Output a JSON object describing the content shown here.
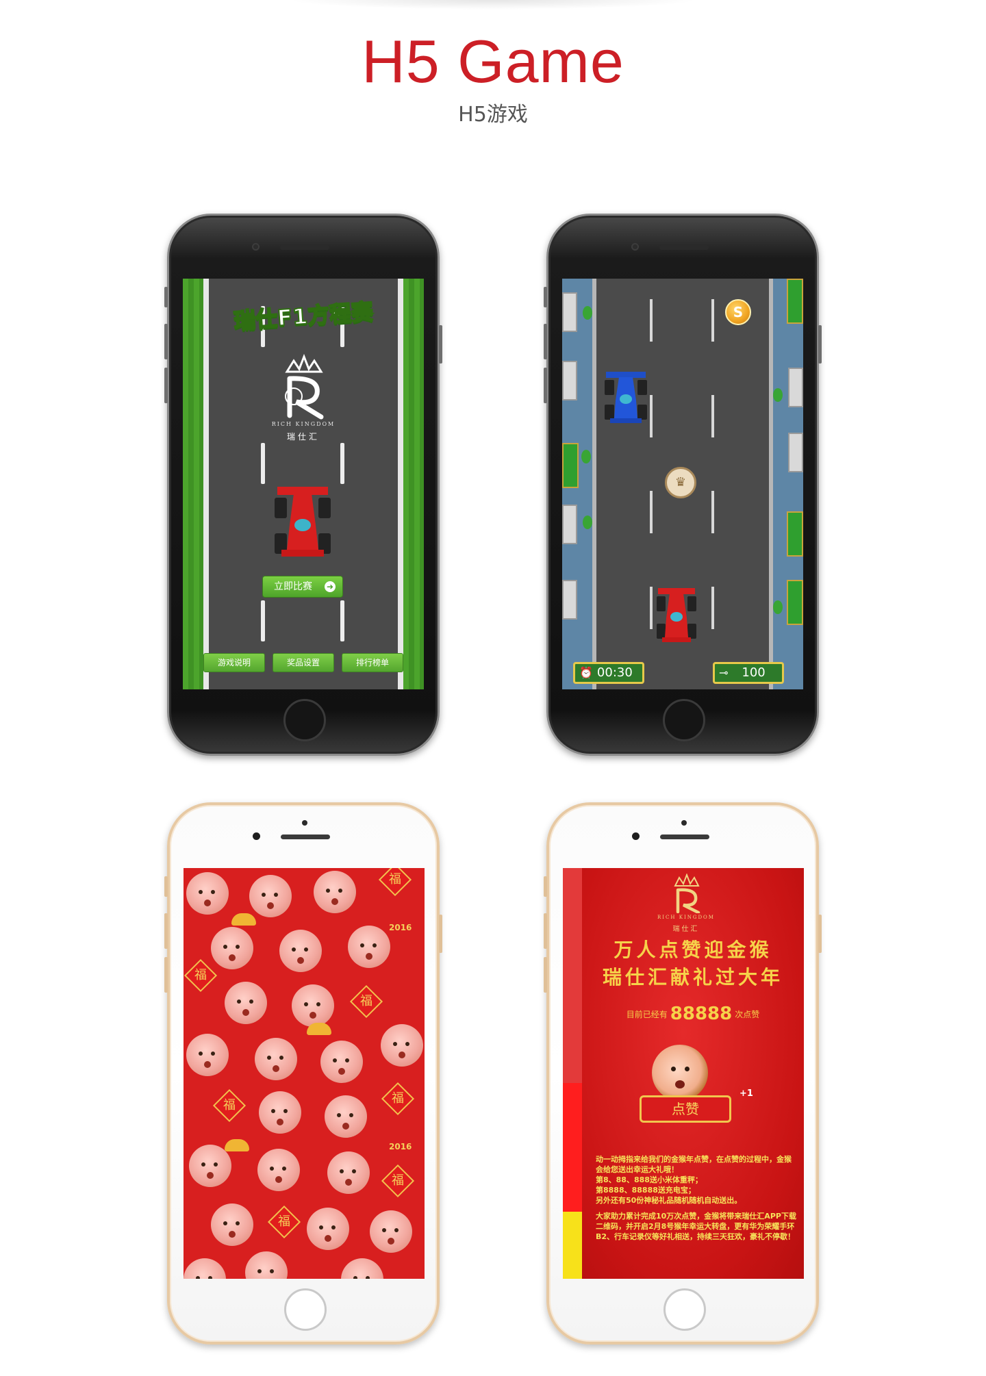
{
  "header": {
    "title": "H5 Game",
    "subtitle": "H5游戏"
  },
  "screen1": {
    "game_title": "瑞仕F1方程赛",
    "brand_en": "RICH KINGDOM",
    "brand_cn": "瑞仕汇",
    "start_button": "立即比赛",
    "nav_buttons": [
      "游戏说明",
      "奖品设置",
      "排行榜单"
    ]
  },
  "screen2": {
    "timer": "00:30",
    "score": "100",
    "coin_symbol": "S"
  },
  "screen3": {
    "fu_char": "福",
    "year_text": "2016"
  },
  "screen4": {
    "brand_en": "RICH KINGDOM",
    "brand_cn": "瑞仕汇",
    "headline_1": "万人点赞迎金猴",
    "headline_2": "瑞仕汇献礼过大年",
    "count_prefix": "目前已经有",
    "count_value": "88888",
    "count_suffix": "次点赞",
    "like_button": "点赞",
    "plus_one": "+1",
    "paragraph_1": "动一动拇指来给我们的金猴年点赞，在点赞的过程中，金猴会给您送出幸运大礼哦！\n第8、88、888送小米体重秤；\n第8888、88888送充电宝；\n另外还有50份神秘礼品随机随机自动送出。",
    "paragraph_2": "大家助力累计完成10万次点赞，金猴将带来瑞仕汇APP下载二维码，并开启2月8号猴年幸运大转盘，更有华为荣耀手环B2、行车记录仪等好礼相送，持续三天狂欢，豪礼不停歇！"
  },
  "colors": {
    "title_red": "#cc1f26",
    "grass_green": "#4ca42c",
    "button_green": "#54a62f",
    "festive_red": "#d81f1f",
    "gold_text": "#f6d24a"
  }
}
